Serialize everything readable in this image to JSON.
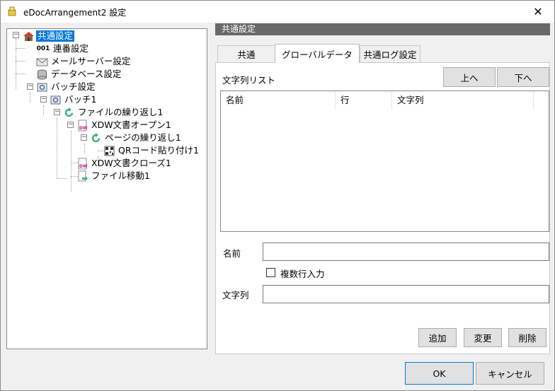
{
  "window": {
    "title": "eDocArrangement2 設定",
    "close_symbol": "✕"
  },
  "tree": {
    "items": [
      {
        "label": "共通設定",
        "icon": "house-icon"
      },
      {
        "label": "連番設定",
        "icon": "sequence-number-icon",
        "prefix": "001"
      },
      {
        "label": "メールサーバー設定",
        "icon": "mail-icon"
      },
      {
        "label": "データベース設定",
        "icon": "database-icon"
      },
      {
        "label": "バッチ設定",
        "icon": "batch-settings-icon"
      },
      {
        "label": "バッチ1",
        "icon": "batch-icon"
      },
      {
        "label": "ファイルの繰り返し1",
        "icon": "loop-icon"
      },
      {
        "label": "XDW文書オープン1",
        "icon": "xdw-document-icon"
      },
      {
        "label": "ページの繰り返し1",
        "icon": "loop-icon"
      },
      {
        "label": "QRコード貼り付け1",
        "icon": "qr-code-icon"
      },
      {
        "label": "XDW文書クローズ1",
        "icon": "xdw-document-icon"
      },
      {
        "label": "ファイル移動1",
        "icon": "file-move-icon"
      }
    ]
  },
  "panel": {
    "header": "共通設定",
    "tabs": [
      {
        "label": "共通",
        "active": false
      },
      {
        "label": "グローバルデータ",
        "active": true
      },
      {
        "label": "共通ログ設定",
        "active": false
      }
    ],
    "string_list_label": "文字列リスト",
    "up_button": "上へ",
    "down_button": "下へ",
    "columns": [
      "名前",
      "行",
      "文字列"
    ],
    "name_label": "名前",
    "name_value": "",
    "multiline_label": "複数行入力",
    "multiline_checked": false,
    "string_label": "文字列",
    "string_value": "",
    "add_button": "追加",
    "change_button": "変更",
    "delete_button": "削除"
  },
  "footer": {
    "ok_button": "OK",
    "cancel_button": "キャンセル"
  },
  "colors": {
    "selection": "#0078d7",
    "header_bar": "#696969",
    "loop_green": "#3cb371"
  }
}
